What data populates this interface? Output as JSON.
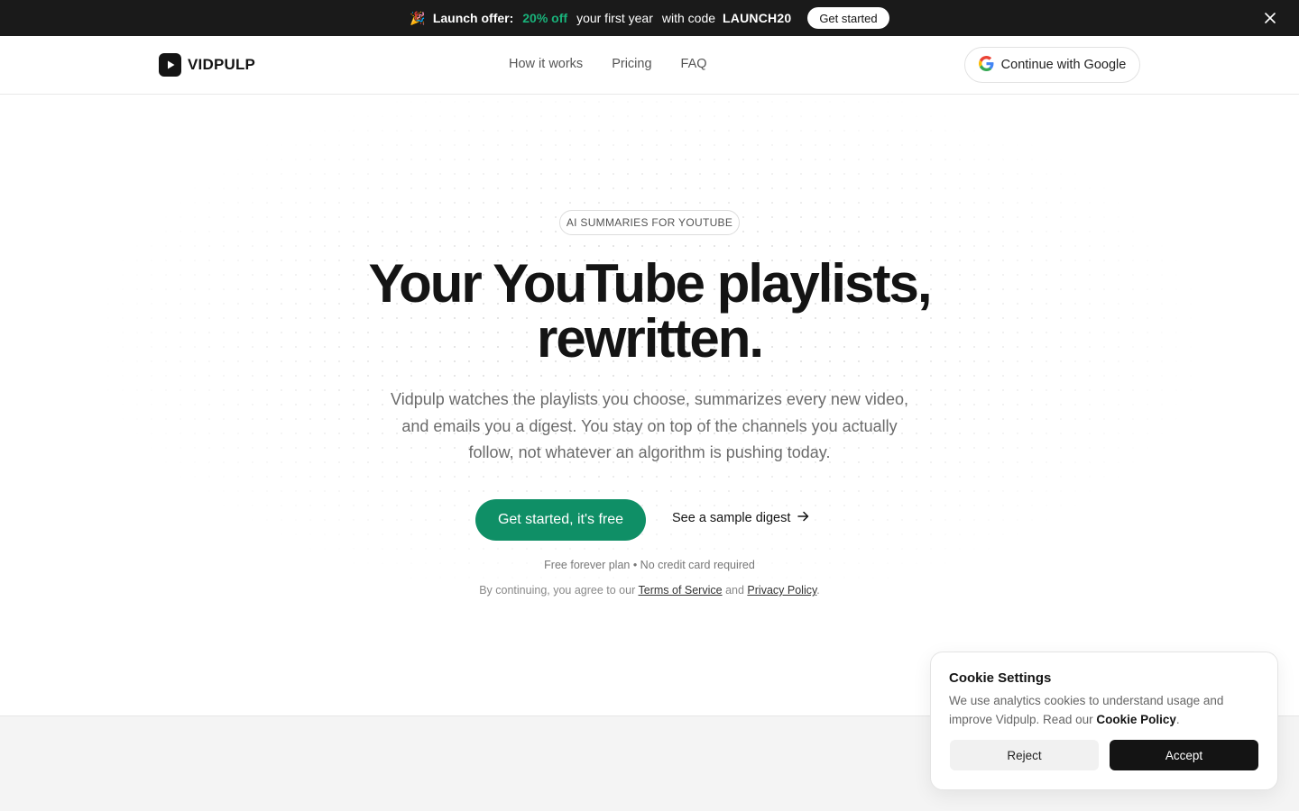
{
  "promo": {
    "emoji": "🎉",
    "title": "Launch offer:",
    "discount": "20% off",
    "text": "your first year",
    "code_prefix": "with code",
    "code": "LAUNCH20",
    "button_label": "Get started"
  },
  "header": {
    "brand": "VIDPULP",
    "nav": [
      "How it works",
      "Pricing",
      "FAQ"
    ],
    "google_button": "Continue with Google"
  },
  "hero": {
    "badge": "AI SUMMARIES FOR YOUTUBE",
    "headline_line1": "Your YouTube playlists,",
    "headline_line2": "rewritten.",
    "subtext": "Vidpulp watches the playlists you choose, summarizes every new video, and emails you a digest. You stay on top of the channels you actually follow, not whatever an algorithm is pushing today.",
    "cta_primary": "Get started, it's free",
    "cta_secondary": "See a sample digest",
    "fine_print": "Free forever plan • No credit card required",
    "consent_prefix": "By continuing, you agree to our",
    "terms_link": "Terms of Service",
    "consent_and": "and",
    "privacy_link": "Privacy Policy",
    "consent_suffix": "."
  },
  "cookie": {
    "title": "Cookie Settings",
    "text": "We use analytics cookies to understand usage and improve Vidpulp. Read our",
    "policy_link": "Cookie Policy",
    "text_suffix": ".",
    "reject_label": "Reject",
    "accept_label": "Accept"
  },
  "colors": {
    "accent_green": "#0f8f66",
    "promo_green": "#19b27a",
    "promo_bg": "#1a1a1a"
  }
}
